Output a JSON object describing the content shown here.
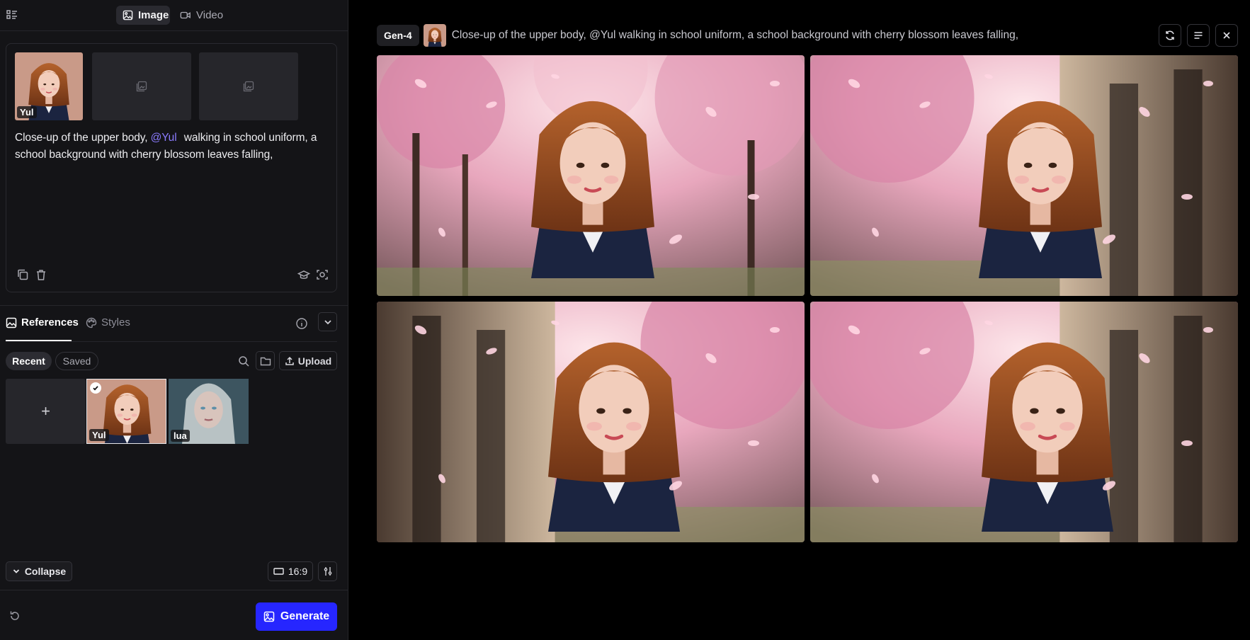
{
  "mode_tabs": {
    "image": "Image",
    "video": "Video"
  },
  "prompt_card": {
    "reference_tag": "Yul",
    "prompt_before": "Close-up of the upper body, ",
    "mention": "@Yul",
    "prompt_after": " walking in school uniform, a school background with cherry blossom leaves falling,"
  },
  "references_panel": {
    "tab_references": "References",
    "tab_styles": "Styles",
    "filter_recent": "Recent",
    "filter_saved": "Saved",
    "upload_label": "Upload",
    "add_symbol": "+",
    "items": [
      {
        "tag": "Yul",
        "selected": true
      },
      {
        "tag": "lua",
        "selected": false
      }
    ]
  },
  "bottom_bar": {
    "collapse_label": "Collapse",
    "aspect_ratio": "16:9",
    "generate_label": "Generate"
  },
  "generation": {
    "model": "Gen-4",
    "prompt": "Close-up of the upper body, @Yul walking in school uniform, a school background with cherry blossom leaves falling,"
  },
  "colors": {
    "accent": "#2626ff",
    "mention": "#8b7bff",
    "panel_bg": "#141417",
    "canvas_bg": "#000000"
  },
  "icons": [
    "menu-icon",
    "image-icon",
    "video-icon",
    "copy-icon",
    "trash-icon",
    "learn-icon",
    "scan-icon",
    "references-icon",
    "palette-icon",
    "info-icon",
    "chevron-down-icon",
    "search-icon",
    "folder-icon",
    "upload-icon",
    "check-icon",
    "aspect-ratio-icon",
    "sliders-icon",
    "reset-icon",
    "refresh-icon",
    "details-icon",
    "close-icon"
  ]
}
